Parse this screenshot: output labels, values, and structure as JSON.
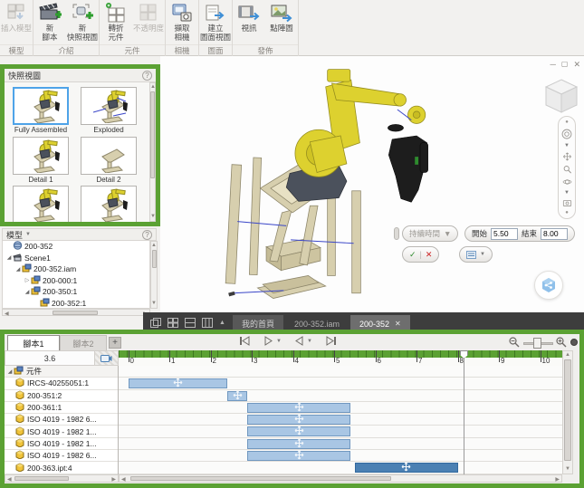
{
  "colors": {
    "annotation_green": "#5ba133",
    "bar_blue": "#a9c6e4",
    "bar_selected_blue": "#4b80b3",
    "selection_accent": "#4ea3e8",
    "tabbar_dark": "#3d3d3d",
    "check_green": "#2e8b2e",
    "cancel_red": "#cc2222"
  },
  "ribbon": {
    "groups": [
      {
        "label": "模型",
        "buttons": [
          {
            "label_lines": [
              "插入模型"
            ],
            "icon": "insert-model-icon",
            "disabled": true
          }
        ]
      },
      {
        "label": "介紹",
        "buttons": [
          {
            "label_lines": [
              "新",
              "腳本"
            ],
            "icon": "new-storyboard-icon",
            "disabled": false
          },
          {
            "label_lines": [
              "新",
              "快照視圖"
            ],
            "icon": "new-snapshot-view-icon",
            "disabled": false
          }
        ]
      },
      {
        "label": "元件",
        "buttons": [
          {
            "label_lines": [
              "轉折",
              "元件"
            ],
            "icon": "tweak-component-icon",
            "disabled": false
          },
          {
            "label_lines": [
              "不透明度"
            ],
            "icon": "opacity-icon",
            "disabled": true
          }
        ]
      },
      {
        "label": "相機",
        "buttons": [
          {
            "label_lines": [
              "擷取",
              "相機"
            ],
            "icon": "capture-camera-icon",
            "disabled": false
          }
        ]
      },
      {
        "label": "圖面",
        "buttons": [
          {
            "label_lines": [
              "建立",
              "圖面視圖"
            ],
            "icon": "create-drawing-view-icon",
            "disabled": false
          }
        ]
      },
      {
        "label": "發佈",
        "buttons": [
          {
            "label_lines": [
              "視訊"
            ],
            "icon": "video-icon",
            "disabled": false
          },
          {
            "label_lines": [
              "點陣圖"
            ],
            "icon": "raster-icon",
            "disabled": false
          }
        ]
      }
    ]
  },
  "snapshot_panel": {
    "title": "快照視圖",
    "views": [
      {
        "label": "Fully Assembled",
        "selected": true,
        "variant": "assembled",
        "clipped": false
      },
      {
        "label": "Exploded",
        "selected": false,
        "variant": "exploded",
        "clipped": false
      },
      {
        "label": "Detail 1",
        "selected": false,
        "variant": "detail1",
        "clipped": false
      },
      {
        "label": "Detail 2",
        "selected": false,
        "variant": "detail2",
        "clipped": false
      },
      {
        "label": "",
        "selected": false,
        "variant": "detail3",
        "clipped": true
      },
      {
        "label": "",
        "selected": false,
        "variant": "detail4",
        "clipped": true
      }
    ]
  },
  "model_panel": {
    "title": "模型",
    "tree": [
      {
        "label": "200-352",
        "depth": 0,
        "icon": "presentation-file-icon",
        "arrow": "none",
        "clipped": false
      },
      {
        "label": "Scene1",
        "depth": 0,
        "icon": "scene-icon",
        "arrow": "expanded",
        "clipped": false
      },
      {
        "label": "200-352.iam",
        "depth": 1,
        "icon": "assembly-icon",
        "arrow": "expanded",
        "clipped": false
      },
      {
        "label": "200-000:1",
        "depth": 2,
        "icon": "assembly-icon",
        "arrow": "collapsed",
        "clipped": false
      },
      {
        "label": "200-350:1",
        "depth": 2,
        "icon": "assembly-icon",
        "arrow": "expanded",
        "clipped": false
      },
      {
        "label": "200-352:1",
        "depth": 3,
        "icon": "assembly-icon",
        "arrow": "none",
        "clipped": true
      }
    ]
  },
  "viewport": {
    "mini_toolbar": {
      "duration_label": "持續時間",
      "start_label": "開始",
      "start_value": "5.50",
      "end_label": "結束",
      "end_value": "8.00"
    }
  },
  "document_tabs": {
    "tabs": [
      {
        "label": "我的首頁",
        "state": "inactive",
        "closable": false
      },
      {
        "label": "200-352.iam",
        "state": "plain",
        "closable": false
      },
      {
        "label": "200-352",
        "state": "active",
        "closable": true
      }
    ]
  },
  "timeline": {
    "script_tabs": [
      {
        "label": "腳本1",
        "active": true
      },
      {
        "label": "腳本2",
        "active": false
      }
    ],
    "add_tab_label": "+",
    "current_time": "3.6",
    "components_header": "元件",
    "ruler": {
      "min": 0,
      "max": 10,
      "tick_labels": [
        "0",
        "1",
        "2",
        "3",
        "4",
        "5",
        "6",
        "7",
        "8",
        "9",
        "10"
      ],
      "playhead": 8.15
    },
    "rows": [
      {
        "name": "IRCS-40255051:1",
        "icon": "part-icon",
        "bar": {
          "start": 0,
          "end": 2.4,
          "selected": false
        }
      },
      {
        "name": "200-351:2",
        "icon": "part-icon",
        "bar": {
          "start": 2.4,
          "end": 2.9,
          "selected": false
        }
      },
      {
        "name": "200-361:1",
        "icon": "part-icon",
        "bar": {
          "start": 2.9,
          "end": 5.4,
          "selected": false
        }
      },
      {
        "name": "ISO 4019 - 1982 6...",
        "icon": "part-icon",
        "bar": {
          "start": 2.9,
          "end": 5.4,
          "selected": false
        }
      },
      {
        "name": "ISO 4019 - 1982 1...",
        "icon": "part-icon",
        "bar": {
          "start": 2.9,
          "end": 5.4,
          "selected": false
        }
      },
      {
        "name": "ISO 4019 - 1982 1...",
        "icon": "part-icon",
        "bar": {
          "start": 2.9,
          "end": 5.4,
          "selected": false
        }
      },
      {
        "name": "ISO 4019 - 1982 6...",
        "icon": "part-icon",
        "bar": {
          "start": 2.9,
          "end": 5.4,
          "selected": false
        }
      },
      {
        "name": "200-363.ipt:4",
        "icon": "part-icon",
        "bar": {
          "start": 5.5,
          "end": 8.0,
          "selected": true
        }
      }
    ]
  }
}
